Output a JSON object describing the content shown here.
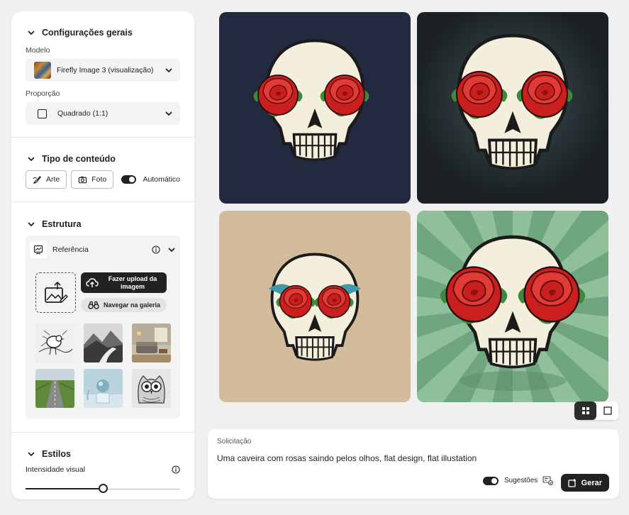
{
  "sidebar": {
    "general": {
      "title": "Configurações gerais",
      "model_label": "Modelo",
      "model_value": "Firefly Image 3 (visualização)",
      "ratio_label": "Proporção",
      "ratio_value": "Quadrado (1:1)"
    },
    "content_type": {
      "title": "Tipo de conteúdo",
      "art_label": "Arte",
      "photo_label": "Foto",
      "auto_label": "Automático",
      "auto_enabled": true
    },
    "structure": {
      "title": "Estrutura",
      "reference_label": "Referência",
      "upload_label_line1": "Fazer upload da",
      "upload_label_line2": "imagem",
      "browse_label": "Navegar na galeria",
      "gallery": [
        "bird-sketch",
        "mountain-river",
        "living-room",
        "road-field",
        "sphere-pedestal",
        "owl-drawing"
      ]
    },
    "styles": {
      "title": "Estilos",
      "intensity_label": "Intensidade visual",
      "intensity_level": 0.5
    }
  },
  "results": [
    {
      "id": "skull-navy",
      "bg": "#232a3f"
    },
    {
      "id": "skull-dark",
      "bg": "#1d2325"
    },
    {
      "id": "skull-tan",
      "bg": "#d1bb9a"
    },
    {
      "id": "skull-green",
      "bg": "#8fbf9b"
    }
  ],
  "view_toggle": {
    "active": "grid"
  },
  "prompt": {
    "label": "Solicitação",
    "text": "Uma caveira com rosas saindo pelos olhos, flat design, flat illustation",
    "suggestions_label": "Sugestões",
    "suggestions_enabled": true,
    "generate_label": "Gerar"
  },
  "colors": {
    "dark": "#222222",
    "panel_bg": "#ffffff",
    "page_bg": "#f0f0f0",
    "rose": "#d42d2b"
  }
}
